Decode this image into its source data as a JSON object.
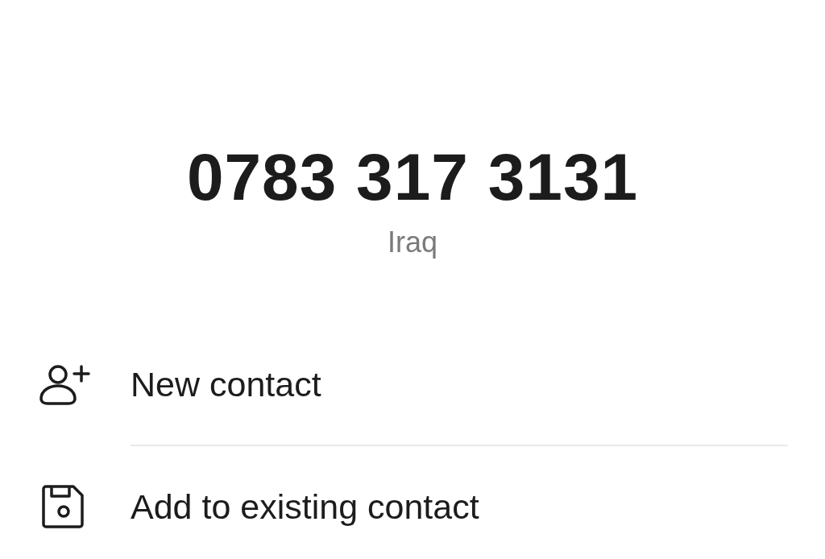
{
  "number": "0783 317 3131",
  "location": "Iraq",
  "actions": [
    {
      "kind": "new-contact",
      "label": "New contact"
    },
    {
      "kind": "existing-contact",
      "label": "Add to existing contact"
    }
  ]
}
